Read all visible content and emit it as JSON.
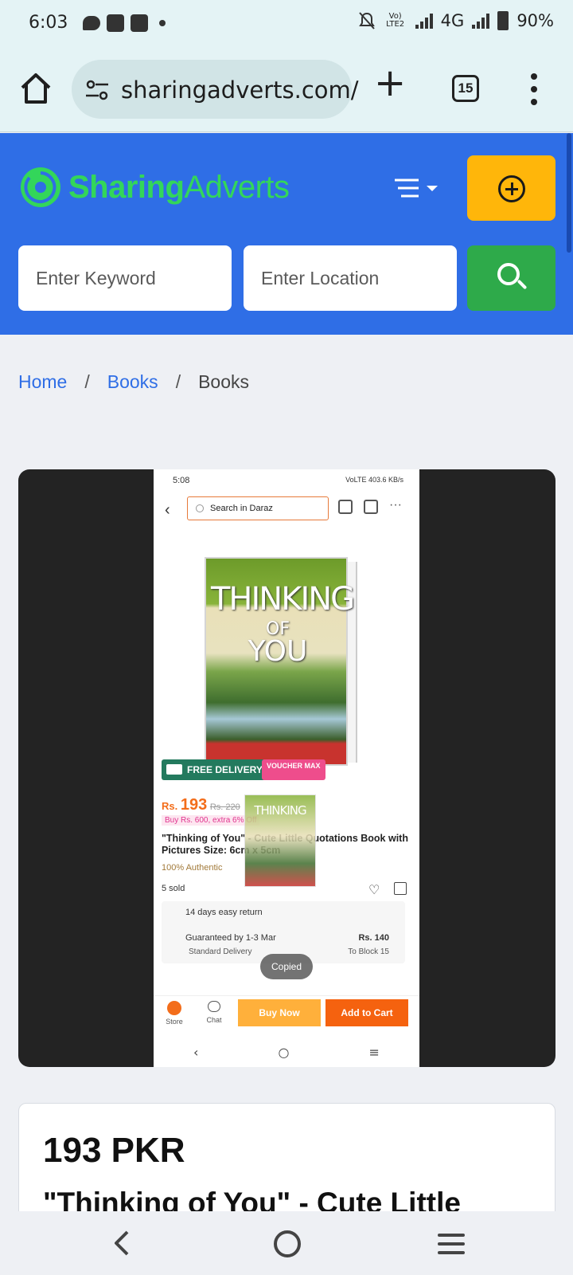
{
  "status_bar": {
    "time": "6:03",
    "network_type": "4G",
    "volte_label": "Vo) LTE2",
    "battery": "90%"
  },
  "browser": {
    "url": "sharingadverts.com/",
    "tab_count": "15"
  },
  "site": {
    "logo_part1": "Sharing",
    "logo_part2": "Adverts",
    "keyword_placeholder": "Enter Keyword",
    "location_placeholder": "Enter Location",
    "colors": {
      "header": "#2f6ee6",
      "logo": "#33d65a",
      "add_button": "#ffb60a",
      "search_button": "#2eaa4a"
    }
  },
  "breadcrumb": {
    "items": [
      "Home",
      "Books",
      "Books"
    ],
    "separator": "/"
  },
  "screenshot": {
    "time": "5:08",
    "status_right": "VoLTE 403.6 KB/s",
    "search_placeholder": "Search in Daraz",
    "book_title_line1": "THINKING",
    "book_title_line2": "OF",
    "book_title_line3": "YOU",
    "free_delivery": "FREE DELIVERY",
    "voucher": "VOUCHER MAX",
    "price_prefix": "Rs.",
    "price": "193",
    "old_price": "Rs. 220",
    "buy_offer": "Buy Rs. 600, extra 6% Off",
    "product_title": "\"Thinking of You\" - Cute Little Quotations Book with Pictures Size: 6cm x 5cm",
    "authentic": "100% Authentic",
    "sold": "5 sold",
    "return_policy": "14 days easy return",
    "guaranteed": "Guaranteed by 1-3 Mar",
    "standard_delivery": "Standard Delivery",
    "delivery_price": "Rs. 140",
    "to_block": "To Block 15",
    "toast": "Copied",
    "store_label": "Store",
    "chat_label": "Chat",
    "buy_now": "Buy Now",
    "add_to_cart": "Add to Cart"
  },
  "listing": {
    "price": "193 PKR",
    "title": "\"Thinking of You\" - Cute Little"
  }
}
